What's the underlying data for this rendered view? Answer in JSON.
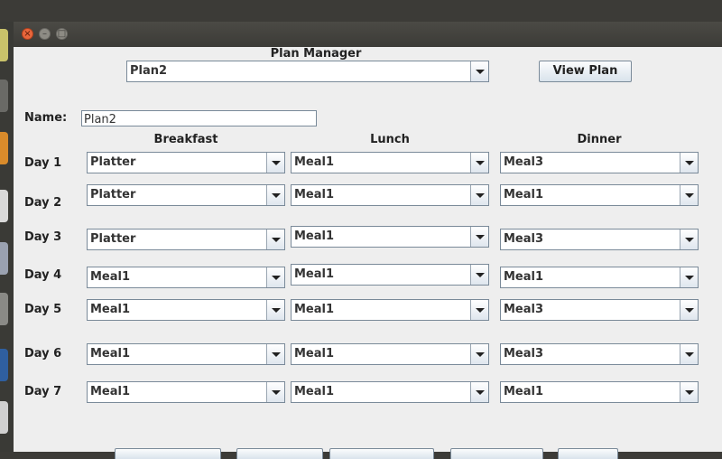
{
  "app": {
    "window_controls": {
      "close_glyph": "×",
      "min_glyph": "–",
      "max_glyph": "□"
    }
  },
  "header": {
    "title": "Plan Manager",
    "plan_selected": "Plan2",
    "view_plan_label": "View Plan"
  },
  "name_field": {
    "label": "Name:",
    "value": "Plan2"
  },
  "columns": {
    "breakfast": "Breakfast",
    "lunch": "Lunch",
    "dinner": "Dinner"
  },
  "days": [
    {
      "label": "Day 1",
      "breakfast": "Platter",
      "lunch": "Meal1",
      "dinner": "Meal3"
    },
    {
      "label": "Day 2",
      "breakfast": "Platter",
      "lunch": "Meal1",
      "dinner": "Meal1"
    },
    {
      "label": "Day 3",
      "breakfast": "Platter",
      "lunch": "Meal1",
      "dinner": "Meal3"
    },
    {
      "label": "Day 4",
      "breakfast": "Meal1",
      "lunch": "Meal1",
      "dinner": "Meal1"
    },
    {
      "label": "Day 5",
      "breakfast": "Meal1",
      "lunch": "Meal1",
      "dinner": "Meal3"
    },
    {
      "label": "Day 6",
      "breakfast": "Meal1",
      "lunch": "Meal1",
      "dinner": "Meal3"
    },
    {
      "label": "Day 7",
      "breakfast": "Meal1",
      "lunch": "Meal1",
      "dinner": "Meal1"
    }
  ]
}
